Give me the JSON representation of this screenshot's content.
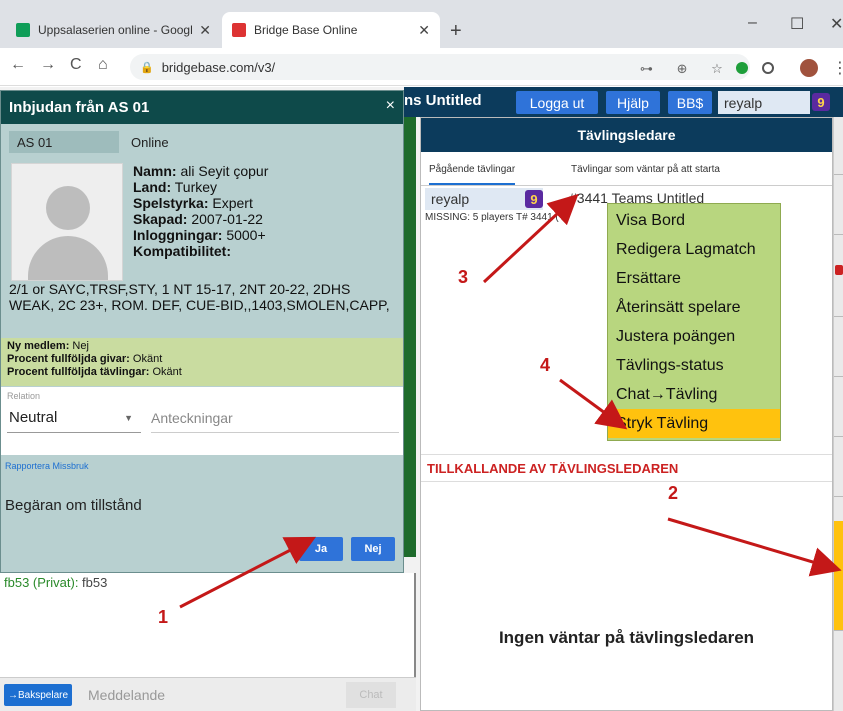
{
  "browser": {
    "tabs": [
      {
        "title": "Uppsalaserien online - Google Sh",
        "active": false
      },
      {
        "title": "Bridge Base Online",
        "active": true
      }
    ],
    "tab_close": "✕",
    "new_tab": "+",
    "url": "bridgebase.com/v3/",
    "window_controls": {
      "minimize": "–",
      "maximize": "☐",
      "close": "✕"
    },
    "nav": {
      "back": "←",
      "forward": "→",
      "reload": "C",
      "home": "⌂"
    }
  },
  "bbo_bar": {
    "title": "ns Untitled",
    "logout": "Logga ut",
    "help": "Hjälp",
    "bb": "BB$",
    "username": "reyalp",
    "badge": "9"
  },
  "dialog": {
    "title": "Inbjudan från AS 01",
    "close": "×",
    "name_field": "AS 01",
    "status": "Online",
    "info": [
      {
        "label": "Namn:",
        "value": "ali Seyit çopur"
      },
      {
        "label": "Land:",
        "value": "Turkey"
      },
      {
        "label": "Spelstyrka:",
        "value": "Expert"
      },
      {
        "label": "Skapad:",
        "value": "2007-01-22"
      },
      {
        "label": "Inloggningar:",
        "value": "5000+"
      },
      {
        "label": "Kompatibilitet:",
        "value": ""
      }
    ],
    "convention_text": "2/1 or SAYC,TRSF,STY, 1 NT 15-17, 2NT 20-22, 2DHS WEAK, 2C 23+, ROM. DEF, CUE-BID,,1403,SMOLEN,CAPP,",
    "stats": [
      {
        "label": "Ny medlem:",
        "value": "Nej"
      },
      {
        "label": "Procent fullföljda givar:",
        "value": "Okänt"
      },
      {
        "label": "Procent fullföljda tävlingar:",
        "value": "Okänt"
      }
    ],
    "relation_label": "Relation",
    "relation_value": "Neutral",
    "notes_placeholder": "Anteckningar",
    "report_link": "Rapportera Missbruk",
    "request_text": "Begäran om tillstånd",
    "yes": "Ja",
    "no": "Nej"
  },
  "chat": {
    "line_user": "fb53 (Privat)",
    "line_text": "fb53",
    "to_button": "→Bakspelare",
    "placeholder": "Meddelande",
    "send": "Chat"
  },
  "td_panel": {
    "header": "Tävlingsledare",
    "tabs": [
      "Pågående tävlingar",
      "Tävlingar som väntar på att starta"
    ],
    "row_user": "reyalp",
    "row_badge": "9",
    "row_title": "#3441 Teams Untitled",
    "missing": "MISSING: 5 players T# 3441 (",
    "call_title": "TILLKALLANDE AV TÄVLINGSLEDAREN",
    "waiting": "Ingen väntar på tävlingsledaren"
  },
  "context_menu": {
    "items": [
      "Visa Bord",
      "Redigera Lagmatch",
      "Ersättare",
      "Återinsätt spelare",
      "Justera poängen",
      "Tävlings-status",
      "Chat→Tävling",
      "Stryk Tävling"
    ],
    "highlighted_index": 7
  },
  "annotations": {
    "n1": "1",
    "n2": "2",
    "n3": "3",
    "n4": "4"
  },
  "colors": {
    "bbo_navy": "#0c3b5c",
    "dialog_teal": "#0e4a4a",
    "button_blue": "#2f73d9",
    "menu_green": "#b8d67f",
    "highlight_yellow": "#ffc20e",
    "annotation_red": "#c41818"
  }
}
